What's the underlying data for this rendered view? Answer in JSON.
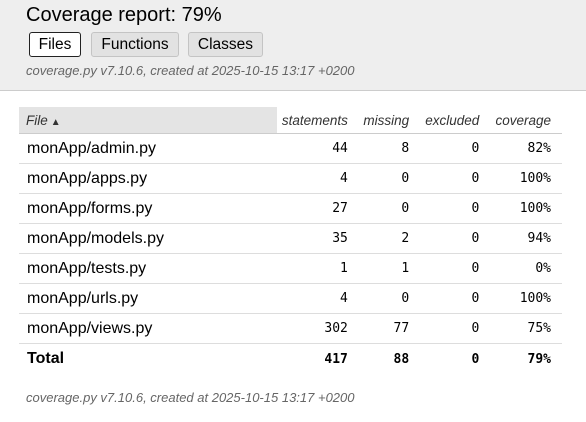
{
  "header": {
    "title": "Coverage report: 79%",
    "tabs": [
      {
        "label": "Files"
      },
      {
        "label": "Functions"
      },
      {
        "label": "Classes"
      }
    ],
    "meta": "coverage.py v7.10.6, created at 2025-10-15 13:17 +0200"
  },
  "table": {
    "columns": {
      "file": "File",
      "sort_arrow": "▲",
      "statements": "statements",
      "missing": "missing",
      "excluded": "excluded",
      "coverage": "coverage"
    },
    "rows": [
      {
        "file": "monApp/admin.py",
        "statements": "44",
        "missing": "8",
        "excluded": "0",
        "coverage": "82%"
      },
      {
        "file": "monApp/apps.py",
        "statements": "4",
        "missing": "0",
        "excluded": "0",
        "coverage": "100%"
      },
      {
        "file": "monApp/forms.py",
        "statements": "27",
        "missing": "0",
        "excluded": "0",
        "coverage": "100%"
      },
      {
        "file": "monApp/models.py",
        "statements": "35",
        "missing": "2",
        "excluded": "0",
        "coverage": "94%"
      },
      {
        "file": "monApp/tests.py",
        "statements": "1",
        "missing": "1",
        "excluded": "0",
        "coverage": "0%"
      },
      {
        "file": "monApp/urls.py",
        "statements": "4",
        "missing": "0",
        "excluded": "0",
        "coverage": "100%"
      },
      {
        "file": "monApp/views.py",
        "statements": "302",
        "missing": "77",
        "excluded": "0",
        "coverage": "75%"
      }
    ],
    "total": {
      "file": "Total",
      "statements": "417",
      "missing": "88",
      "excluded": "0",
      "coverage": "79%"
    }
  },
  "footer": {
    "meta": "coverage.py v7.10.6, created at 2025-10-15 13:17 +0200"
  }
}
